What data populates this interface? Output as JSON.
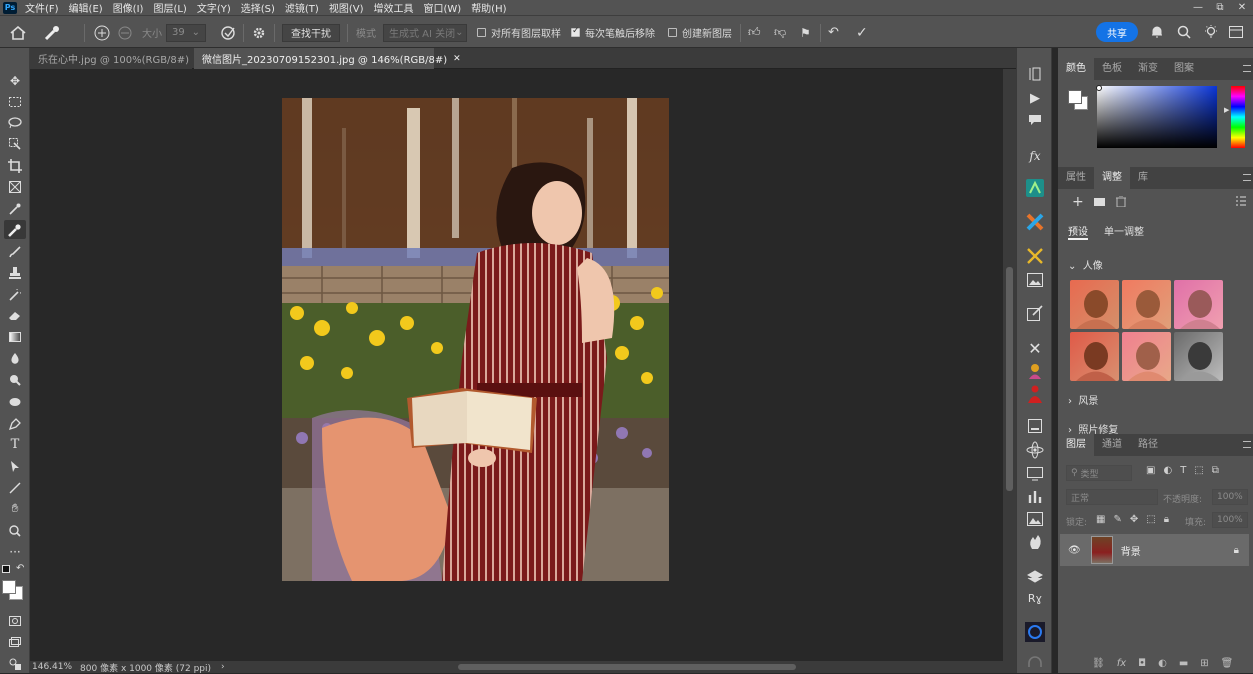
{
  "menubar": {
    "logo": "Ps",
    "items": [
      "文件(F)",
      "编辑(E)",
      "图像(I)",
      "图层(L)",
      "文字(Y)",
      "选择(S)",
      "滤镜(T)",
      "视图(V)",
      "增效工具",
      "窗口(W)",
      "帮助(H)"
    ],
    "controls": [
      "—",
      "⧉",
      "✕"
    ]
  },
  "options": {
    "size_label": "大小",
    "size_value": "39",
    "find_distractions": "查找干扰",
    "mode_label": "模式",
    "mode_value": "生成式 AI 关闭",
    "sample_all_layers": "对所有图层取样",
    "remove_after_stroke": "每次笔触后移除",
    "new_layer": "创建新图层",
    "share": "共享"
  },
  "tabs": [
    {
      "label": "乐在心中.jpg @ 100%(RGB/8#)",
      "active": false
    },
    {
      "label": "微信图片_20230709152301.jpg @ 146%(RGB/8#)",
      "active": true
    }
  ],
  "status": {
    "zoom": "146.41%",
    "doc_info": "800 像素 x 1000 像素 (72 ppi)",
    "arrow": "›"
  },
  "color_panel": {
    "tabs": [
      "颜色",
      "色板",
      "渐变",
      "图案"
    ],
    "foreground": "#ffffff",
    "background": "#ffffff"
  },
  "adjust_panel": {
    "tabs": [
      "属性",
      "调整",
      "库"
    ],
    "subtabs": [
      "预设",
      "单一调整"
    ],
    "portrait_label": "人像",
    "landscape_label": "风景",
    "photo_fix_label": "照片修复"
  },
  "layers_panel": {
    "tabs": [
      "图层",
      "通道",
      "路径"
    ],
    "filter_placeholder": "类型",
    "blend_mode": "正常",
    "opacity_label": "不透明度:",
    "opacity_value": "100%",
    "lock_label": "锁定:",
    "fill_label": "填充:",
    "fill_value": "100%",
    "layer_name": "背景"
  },
  "colors": {
    "accent": "#1473e6",
    "panel_bg": "#535353",
    "canvas_bg": "#282828"
  }
}
